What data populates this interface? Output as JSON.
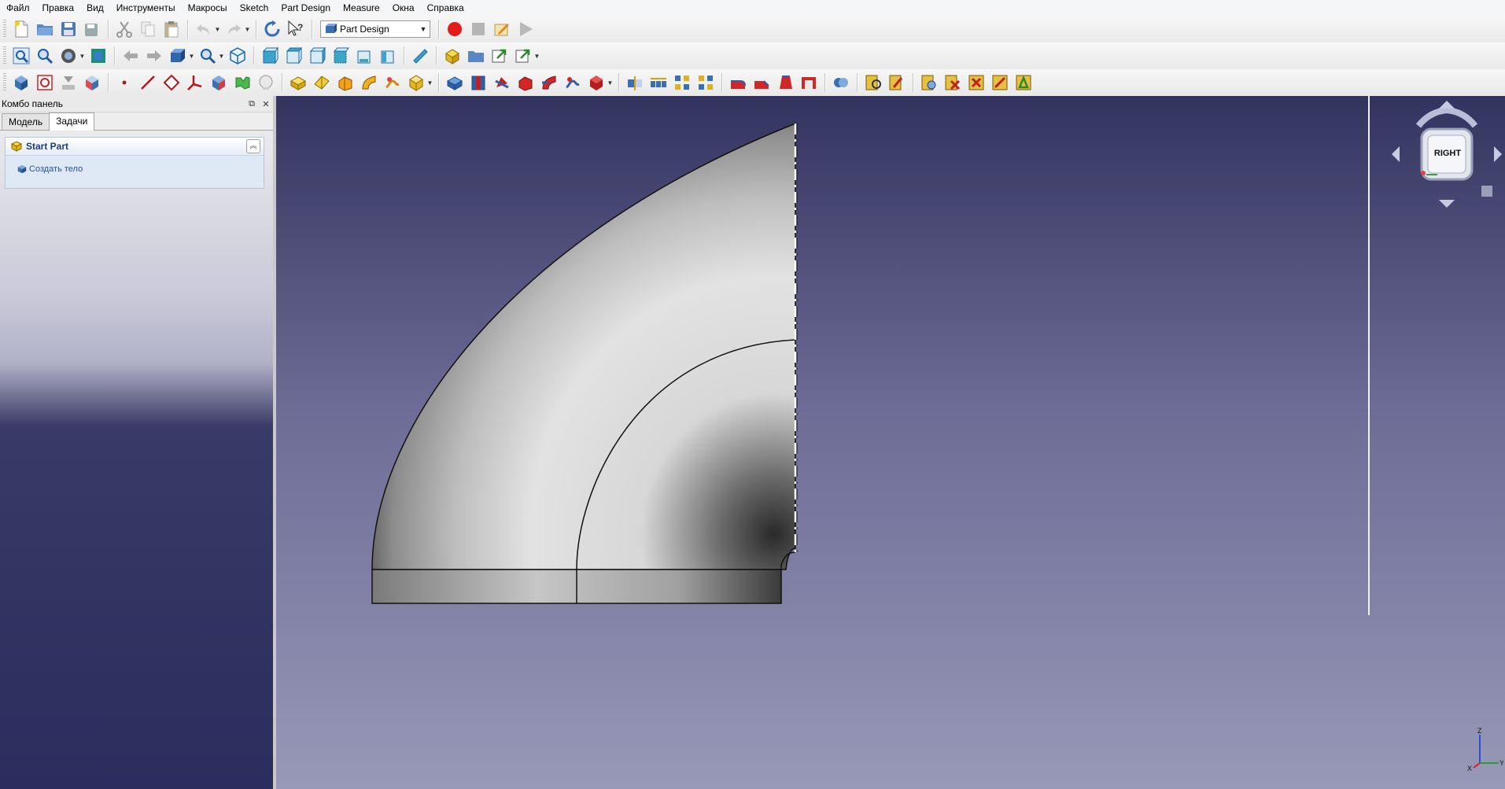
{
  "menu": [
    "Файл",
    "Правка",
    "Вид",
    "Инструменты",
    "Макросы",
    "Sketch",
    "Part Design",
    "Measure",
    "Окна",
    "Справка"
  ],
  "workbench": {
    "selected": "Part Design"
  },
  "combo_panel": {
    "title": "Комбо панель",
    "tabs": [
      "Модель",
      "Задачи"
    ],
    "active_tab": "Задачи",
    "task_title": "Start Part",
    "task_action": "Создать тело"
  },
  "viewport": {
    "background_top": "#33335f",
    "background_bottom": "#9898b8",
    "navcube_face": "RIGHT",
    "axis_labels": [
      "Z",
      "Y",
      "X"
    ]
  }
}
